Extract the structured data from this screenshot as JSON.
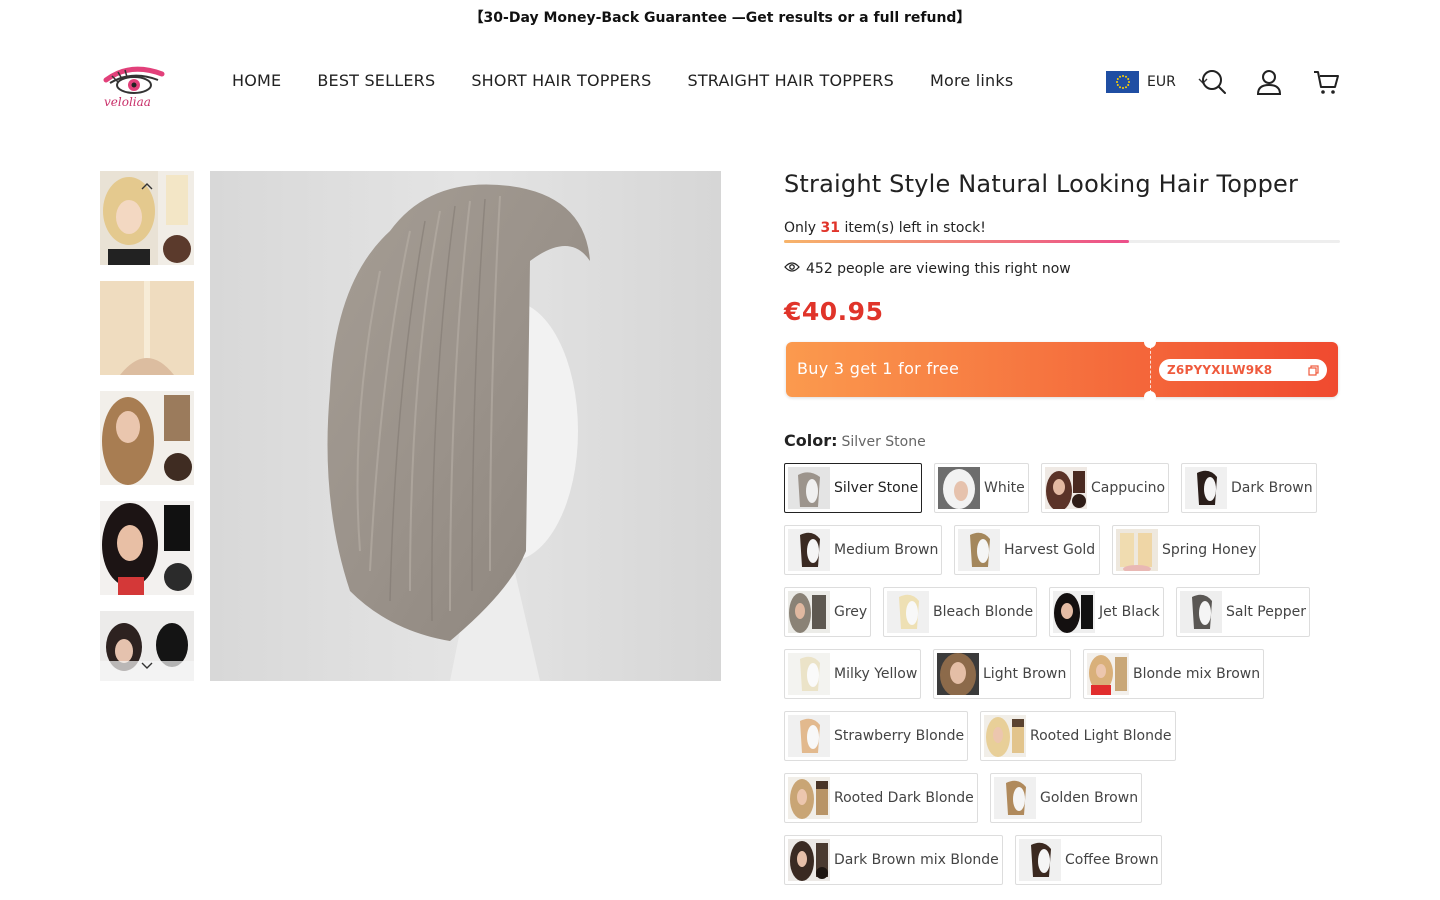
{
  "announcement": "【30-Day Money-Back Guarantee —Get results or a full refund】",
  "brand": {
    "logo_text": "veloliaa"
  },
  "nav": [
    "HOME",
    "BEST SELLERS",
    "SHORT HAIR TOPPERS",
    "STRAIGHT HAIR TOPPERS",
    "More links"
  ],
  "currency": {
    "code": "EUR"
  },
  "icons": [
    "eu-flag-icon",
    "chevron-down-icon",
    "search-icon",
    "account-icon",
    "cart-icon",
    "chevron-up-icon",
    "eye-icon",
    "copy-icon"
  ],
  "product": {
    "title": "Straight Style Natural Looking Hair Topper",
    "stock_prefix": "Only ",
    "stock_count": "31",
    "stock_suffix": " item(s) left in stock!",
    "stock_level_fraction": 0.62,
    "viewers": "452 people are viewing this right now",
    "price": "€40.95",
    "coupon_text": "Buy 3 get 1 for free",
    "coupon_code": "Z6PYYXILW9K8",
    "color_label": "Color:",
    "selected_color": "Silver Stone",
    "colors": [
      "Silver Stone",
      "White",
      "Cappucino",
      "Dark Brown",
      "Medium Brown",
      "Harvest Gold",
      "Spring Honey",
      "Grey",
      "Bleach Blonde",
      "Jet Black",
      "Salt Pepper",
      "Milky Yellow",
      "Light Brown",
      "Blonde mix Brown",
      "Strawberry Blonde",
      "Rooted Light Blonde",
      "Rooted Dark Blonde",
      "Golden Brown",
      "Dark Brown mix Blonde",
      "Coffee Brown"
    ]
  },
  "colors_theme": {
    "accent": "#e0342a",
    "coupon_start": "#fb9a4e",
    "coupon_end": "#f04a2f"
  }
}
